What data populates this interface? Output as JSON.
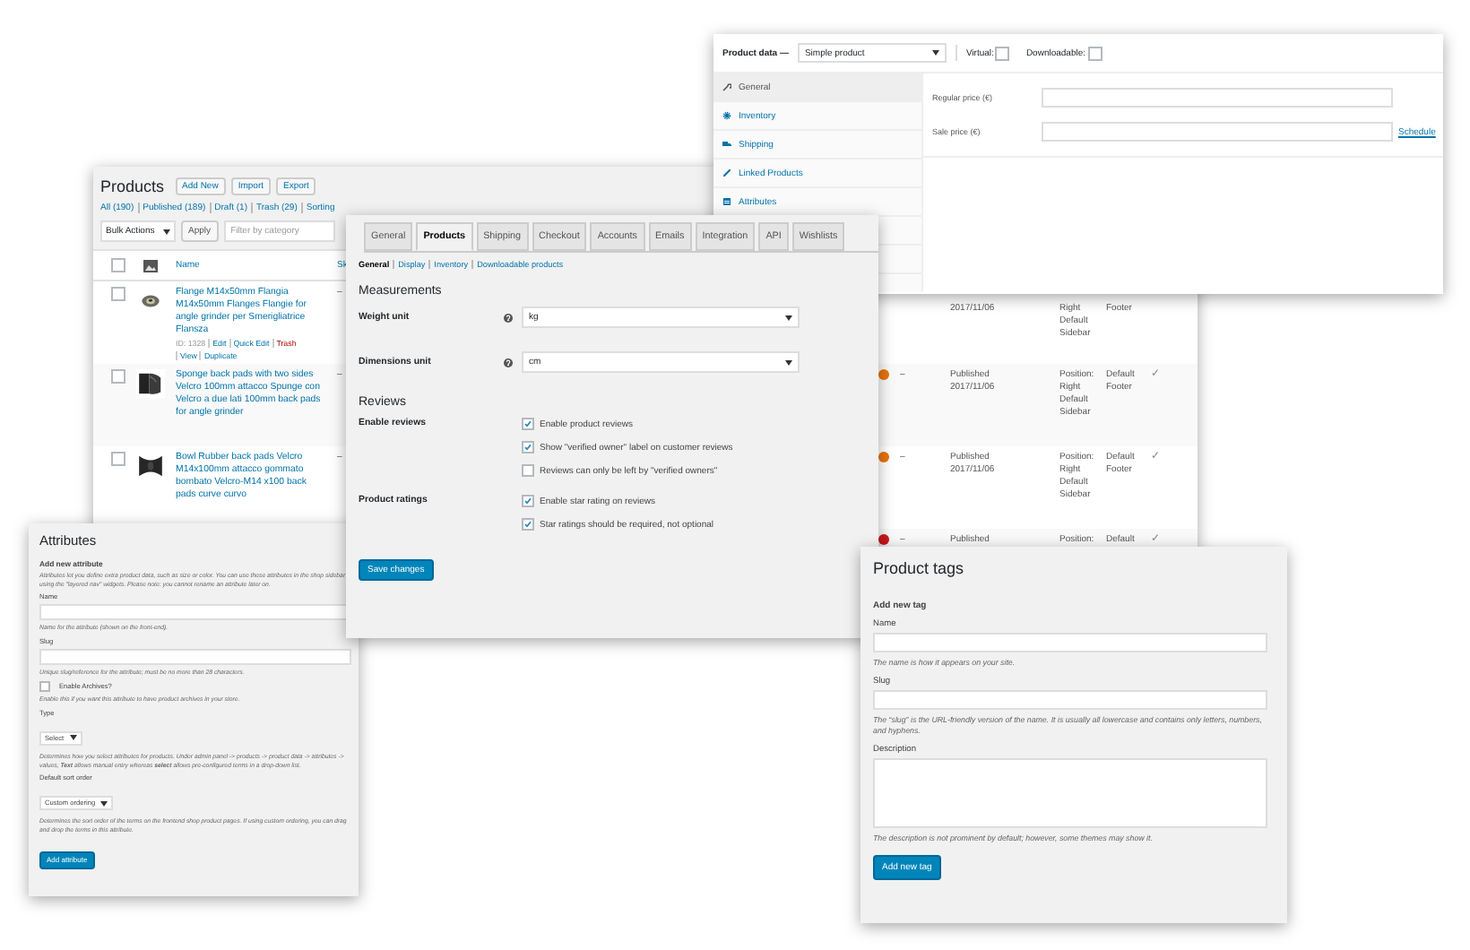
{
  "products_list": {
    "title": "Products",
    "buttons": [
      "Add New",
      "Import",
      "Export"
    ],
    "filters": [
      "All (190)",
      "Published (189)",
      "Draft (1)",
      "Trash (29)",
      "Sorting"
    ],
    "bulk_actions": "Bulk Actions",
    "apply": "Apply",
    "category_placeholder": "Filter by category",
    "header_checked": false,
    "columns": [
      "Name",
      "Sk"
    ],
    "rows": [
      {
        "checked": false,
        "name": "Flange M14x50mm Flangia M14x50mm Flanges Flangie for angle grinder per Smerigliatrice Flansza",
        "actions": [
          {
            "label": "ID: 1328",
            "kind": "text"
          },
          {
            "label": "Edit",
            "kind": "link"
          },
          {
            "label": "Quick Edit",
            "kind": "link"
          },
          {
            "label": "Trash",
            "kind": "danger"
          },
          {
            "label": "View",
            "kind": "link"
          },
          {
            "label": "Duplicate",
            "kind": "link"
          }
        ],
        "sku": "–",
        "date": "2017/11/06",
        "layout": "Right Default Sidebar",
        "footer": "Footer"
      },
      {
        "checked": false,
        "name": "Sponge back pads with two sides Velcro 100mm attacco Spunge con Velcro a due lati 100mm back pads for angle grinder",
        "sku": "–",
        "color": "#e8730c",
        "dash": "–",
        "status": "Published",
        "date": "2017/11/06",
        "layout": "Position: Right Default Sidebar",
        "footer": "Default Footer",
        "mark": "✓"
      },
      {
        "checked": false,
        "name": "Bowl Rubber back pads Velcro M14x100mm attacco gommato bombato Velcro-M14 x100 back pads curve curvo",
        "sku": "–",
        "color": "#e8730c",
        "dash": "–",
        "status": "Published",
        "date": "2017/11/06",
        "layout": "Position: Right Default Sidebar",
        "footer": "Default Footer",
        "mark": "✓"
      },
      {
        "color": "#d0181c",
        "dash": "–",
        "status": "Published",
        "layout": "Position:",
        "footer": "Default",
        "mark": "✓"
      }
    ]
  },
  "product_data": {
    "label": "Product data —",
    "type_value": "Simple product",
    "options": [
      {
        "label": "Virtual:",
        "checked": false
      },
      {
        "label": "Downloadable:",
        "checked": false
      }
    ],
    "tabs": [
      {
        "label": "General",
        "selected": true
      },
      {
        "label": "Inventory",
        "selected": false
      },
      {
        "label": "Shipping",
        "selected": false
      },
      {
        "label": "Linked Products",
        "selected": false
      },
      {
        "label": "Attributes",
        "selected": false
      }
    ],
    "fields": [
      {
        "label": "Regular price (€)"
      },
      {
        "label": "Sale price (€)",
        "link": "Schedule"
      }
    ]
  },
  "settings": {
    "tabs": [
      {
        "label": "General",
        "selected": false
      },
      {
        "label": "Products",
        "selected": true
      },
      {
        "label": "Shipping",
        "selected": false
      },
      {
        "label": "Checkout",
        "selected": false
      },
      {
        "label": "Accounts",
        "selected": false
      },
      {
        "label": "Emails",
        "selected": false
      },
      {
        "label": "Integration",
        "selected": false
      },
      {
        "label": "API",
        "selected": false
      },
      {
        "label": "Wishlists",
        "selected": false
      }
    ],
    "subnav": [
      {
        "label": "General",
        "selected": true
      },
      {
        "label": "Display",
        "selected": false
      },
      {
        "label": "Inventory",
        "selected": false
      },
      {
        "label": "Downloadable products",
        "selected": false
      }
    ],
    "sections": [
      {
        "title": "Measurements",
        "rows": [
          {
            "label": "Weight unit",
            "kind": "select",
            "help": true,
            "value": "kg"
          },
          {
            "label": "Dimensions unit",
            "kind": "select",
            "help": true,
            "value": "cm"
          }
        ]
      },
      {
        "title": "Reviews",
        "rows": [
          {
            "label": "Enable reviews",
            "kind": "checks",
            "options": [
              {
                "label": "Enable product reviews",
                "checked": true
              },
              {
                "label": "Show \"verified owner\" label on customer reviews",
                "checked": true
              },
              {
                "label": "Reviews can only be left by \"verified owners\"",
                "checked": false
              }
            ]
          },
          {
            "label": "Product ratings",
            "kind": "checks",
            "options": [
              {
                "label": "Enable star rating on reviews",
                "checked": true
              },
              {
                "label": "Star ratings should be required, not optional",
                "checked": true
              }
            ]
          }
        ]
      }
    ],
    "save": "Save changes"
  },
  "attributes": {
    "title": "Attributes",
    "subtitle": "Add new attribute",
    "intro": "Attributes let you define extra product data, such as size or color. You can use these attributes in the shop sidebar using the \"layered nav\" widgets. Please note: you cannot rename an attribute later on.",
    "fields": [
      {
        "kind": "text",
        "label": "Name",
        "hint": "Name for the attribute (shown on the front-end)."
      },
      {
        "kind": "text",
        "label": "Slug",
        "hint": "Unique slug/reference for the attribute; must be no more than 28 characters."
      },
      {
        "kind": "checkbox",
        "label": "Enable Archives?",
        "checked": false,
        "hint": "Enable this if you want this attribute to have product archives in your store."
      },
      {
        "kind": "select",
        "label": "Type",
        "value": "Select",
        "hint": "Determines how you select attributes for products. Under admin panel -> products -> product data -> attributes -> values, **Text** allows manual entry whereas **select** allows pre-configured terms in a drop-down list."
      },
      {
        "kind": "select",
        "label": "Default sort order",
        "value": "Custom ordering",
        "hint": "Determines the sort order of the terms on the frontend shop product pages. If using custom ordering, you can drag and drop the terms in this attribute."
      }
    ],
    "button": "Add attribute"
  },
  "product_tags": {
    "title": "Product tags",
    "subtitle": "Add new tag",
    "fields": [
      {
        "kind": "text",
        "label": "Name",
        "hint": "The name is how it appears on your site."
      },
      {
        "kind": "text",
        "label": "Slug",
        "hint": "The “slug” is the URL-friendly version of the name. It is usually all lowercase and contains only letters, numbers, and hyphens."
      },
      {
        "kind": "textarea",
        "label": "Description",
        "hint": "The description is not prominent by default; however, some themes may show it."
      }
    ],
    "button": "Add new tag"
  }
}
